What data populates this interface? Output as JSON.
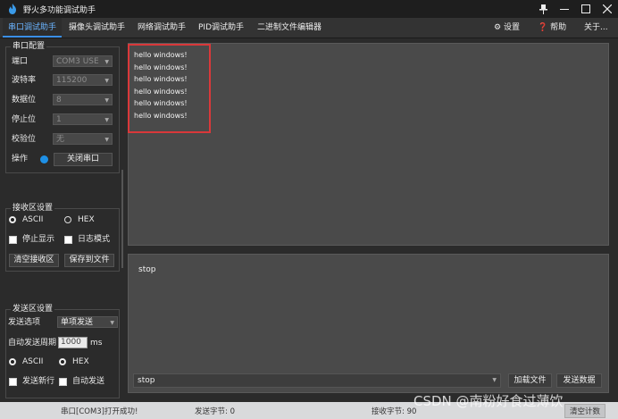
{
  "window": {
    "title": "野火多功能调试助手",
    "controls": {
      "pin": "⬝",
      "minimize": "—",
      "maximize": "☐",
      "close": "✕"
    }
  },
  "tabs": [
    {
      "label": "串口调试助手",
      "active": true
    },
    {
      "label": "摄像头调试助手",
      "active": false
    },
    {
      "label": "网络调试助手",
      "active": false
    },
    {
      "label": "PID调试助手",
      "active": false
    },
    {
      "label": "二进制文件编辑器",
      "active": false
    }
  ],
  "toolbar": {
    "settings": "设置",
    "help": "帮助",
    "about": "关于..."
  },
  "serial_config": {
    "title": "串口配置",
    "port_label": "端口",
    "port_value": "COM3 USE",
    "baud_label": "波特率",
    "baud_value": "115200",
    "databits_label": "数据位",
    "databits_value": "8",
    "stopbits_label": "停止位",
    "stopbits_value": "1",
    "parity_label": "校验位",
    "parity_value": "无",
    "operation_label": "操作",
    "close_port_button": "关闭串口"
  },
  "receive_settings": {
    "title": "接收区设置",
    "ascii": "ASCII",
    "hex": "HEX",
    "stop_display": "停止显示",
    "log_mode": "日志模式",
    "clear_button": "清空接收区",
    "save_button": "保存到文件"
  },
  "send_settings": {
    "title": "发送区设置",
    "option_label": "发送选项",
    "option_value": "单项发送",
    "period_label": "自动发送周期",
    "period_value": "1000",
    "period_unit": "ms",
    "ascii": "ASCII",
    "hex": "HEX",
    "newline": "发送新行",
    "auto_send": "自动发送"
  },
  "receive_area": {
    "lines": [
      "hello windows!",
      "hello windows!",
      "hello windows!",
      "hello windows!",
      "hello windows!",
      "hello windows!"
    ]
  },
  "send_area": {
    "text": "stop",
    "input_value": "stop",
    "load_file_button": "加载文件",
    "send_button": "发送数据"
  },
  "status": {
    "message": "串口[COM3]打开成功!",
    "sent_bytes": "发送字节: 0",
    "recv_bytes": "接收字节: 90",
    "reset_button": "清空计数"
  },
  "watermark": "CSDN @南粉好食过薄饮",
  "colors": {
    "accent": "#3a8ee6",
    "highlight": "#d9383a"
  }
}
